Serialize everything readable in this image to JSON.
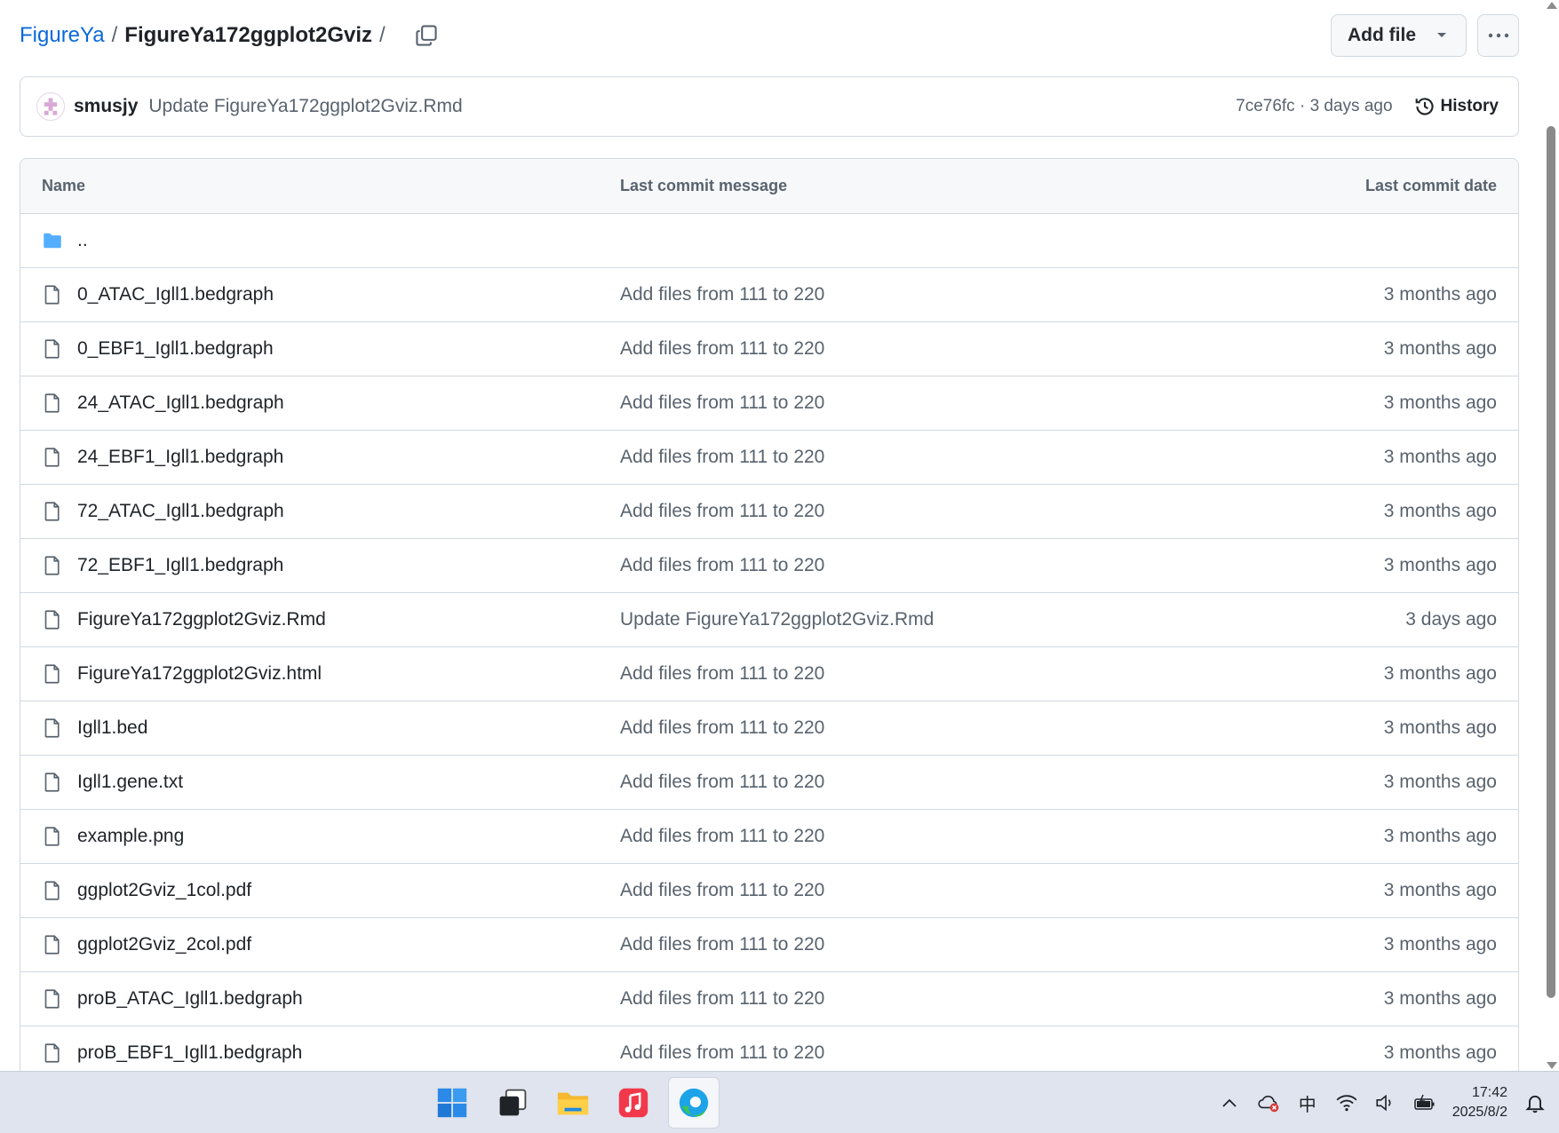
{
  "breadcrumb": {
    "owner": "FigureYa",
    "repo": "FigureYa172ggplot2Gviz",
    "sep": "/",
    "trail_sep": "/"
  },
  "actions": {
    "add_file": "Add file"
  },
  "commit": {
    "user": "smusjy",
    "message": "Update FigureYa172ggplot2Gviz.Rmd",
    "sha_time": "7ce76fc · 3 days ago",
    "history": "History"
  },
  "table": {
    "headers": {
      "name": "Name",
      "message": "Last commit message",
      "date": "Last commit date"
    },
    "parent": "..",
    "rows": [
      {
        "name": "0_ATAC_Igll1.bedgraph",
        "message": "Add files from 111 to 220",
        "date": "3 months ago"
      },
      {
        "name": "0_EBF1_Igll1.bedgraph",
        "message": "Add files from 111 to 220",
        "date": "3 months ago"
      },
      {
        "name": "24_ATAC_Igll1.bedgraph",
        "message": "Add files from 111 to 220",
        "date": "3 months ago"
      },
      {
        "name": "24_EBF1_Igll1.bedgraph",
        "message": "Add files from 111 to 220",
        "date": "3 months ago"
      },
      {
        "name": "72_ATAC_Igll1.bedgraph",
        "message": "Add files from 111 to 220",
        "date": "3 months ago"
      },
      {
        "name": "72_EBF1_Igll1.bedgraph",
        "message": "Add files from 111 to 220",
        "date": "3 months ago"
      },
      {
        "name": "FigureYa172ggplot2Gviz.Rmd",
        "message": "Update FigureYa172ggplot2Gviz.Rmd",
        "date": "3 days ago"
      },
      {
        "name": "FigureYa172ggplot2Gviz.html",
        "message": "Add files from 111 to 220",
        "date": "3 months ago"
      },
      {
        "name": "Igll1.bed",
        "message": "Add files from 111 to 220",
        "date": "3 months ago"
      },
      {
        "name": "Igll1.gene.txt",
        "message": "Add files from 111 to 220",
        "date": "3 months ago"
      },
      {
        "name": "example.png",
        "message": "Add files from 111 to 220",
        "date": "3 months ago"
      },
      {
        "name": "ggplot2Gviz_1col.pdf",
        "message": "Add files from 111 to 220",
        "date": "3 months ago"
      },
      {
        "name": "ggplot2Gviz_2col.pdf",
        "message": "Add files from 111 to 220",
        "date": "3 months ago"
      },
      {
        "name": "proB_ATAC_Igll1.bedgraph",
        "message": "Add files from 111 to 220",
        "date": "3 months ago"
      },
      {
        "name": "proB_EBF1_Igll1.bedgraph",
        "message": "Add files from 111 to 220",
        "date": "3 months ago"
      }
    ]
  },
  "taskbar": {
    "apps": [
      "windows-start-icon",
      "task-view-icon",
      "file-explorer-icon",
      "music-app-icon",
      "edge-browser-icon"
    ],
    "ime": "中",
    "time": "17:42",
    "date": "2025/8/2"
  },
  "colors": {
    "link": "#0969da",
    "border": "#d1d9e0",
    "muted": "#59636e",
    "folder": "#54aeff"
  }
}
